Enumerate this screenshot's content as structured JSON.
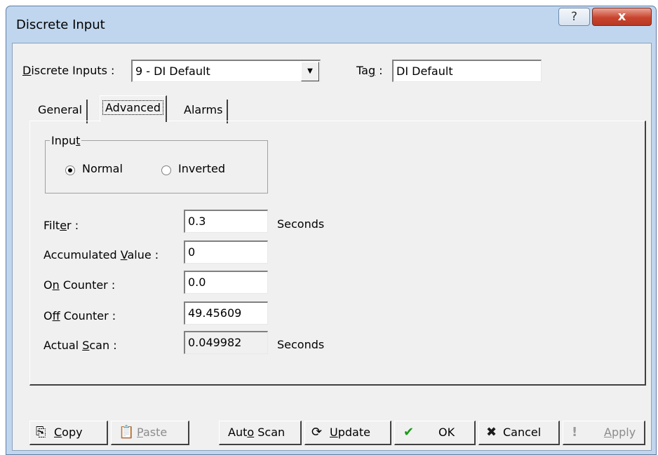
{
  "window": {
    "title": "Discrete Input",
    "help_label": "?",
    "close_label": "x"
  },
  "header": {
    "discrete_inputs_label_u": "D",
    "discrete_inputs_label_rest": "iscrete Inputs :",
    "discrete_inputs_value": "9 - DI Default",
    "tag_label_pre": "Ta",
    "tag_label_u": "g",
    "tag_label_post": " :",
    "tag_value": "DI Default"
  },
  "tabs": [
    {
      "label": "General"
    },
    {
      "label": "Advanced"
    },
    {
      "label": "Alarms"
    }
  ],
  "input_group": {
    "title_pre": "Inpu",
    "title_u": "t",
    "selected": "Normal",
    "options": [
      {
        "label": "Normal"
      },
      {
        "label": "Inverted"
      }
    ]
  },
  "fields": {
    "filter": {
      "label_pre": "Filt",
      "label_u": "e",
      "label_post": "r :",
      "value": "0.3",
      "unit": "Seconds"
    },
    "accumulated": {
      "label_pre": "Accumulated ",
      "label_u": "V",
      "label_post": "alue :",
      "value": "0"
    },
    "on_counter": {
      "label_pre": "O",
      "label_u": "n",
      "label_post": " Counter :",
      "value": "0.0"
    },
    "off_counter": {
      "label_pre": "O",
      "label_u": "f",
      "label_post": "f Counter :",
      "value": "49.45609"
    },
    "actual_scan": {
      "label_pre": "Actual ",
      "label_u": "S",
      "label_post": "can :",
      "value": "0.049982",
      "unit": "Seconds"
    }
  },
  "buttons": {
    "copy": {
      "u": "C",
      "rest": "opy"
    },
    "paste": {
      "u": "P",
      "rest": "aste"
    },
    "auto_scan": {
      "pre": "Aut",
      "u": "o",
      "post": " Scan"
    },
    "update": {
      "u": "U",
      "rest": "pdate"
    },
    "ok": {
      "label": "OK"
    },
    "cancel": {
      "label": "Cancel"
    },
    "apply": {
      "u": "A",
      "rest": "pply"
    }
  },
  "colors": {
    "close_red": "#c9442e",
    "ok_check": "#1a9a1a",
    "cancel_x": "#1a1a1a"
  }
}
